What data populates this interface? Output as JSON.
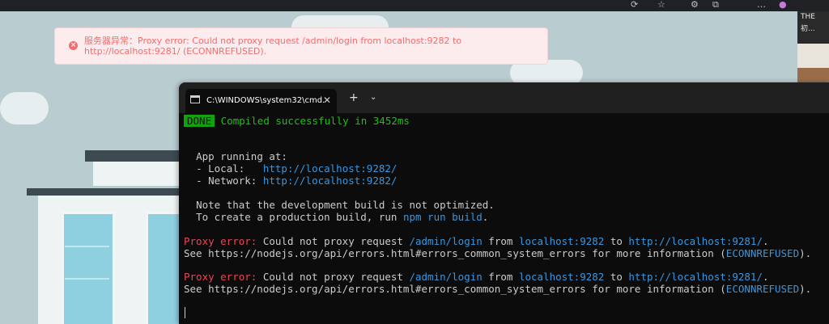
{
  "toast": {
    "message": "服务器异常：Proxy error: Could not proxy request /admin/login from localhost:9282 to http://localhost:9281/ (ECONNREFUSED).",
    "color": "#f56c6c"
  },
  "right_edge": {
    "text_line1": "THE",
    "text_line2": "初..."
  },
  "terminal": {
    "tab_title": "C:\\WINDOWS\\system32\\cmd.",
    "close_glyph": "✕",
    "new_tab_glyph": "+",
    "dropdown_glyph": "⌄",
    "done_badge": "DONE",
    "compiled_msg": "Compiled successfully in 3452ms",
    "app_running": "App running at:",
    "local_label": "- Local:   ",
    "local_url": "http://localhost:9282/",
    "network_label": "- Network: ",
    "network_url": "http://localhost:9282/",
    "note_line1": "Note that the development build is not optimized.",
    "note_line2_prefix": "To create a production build, run ",
    "note_line2_cmd": "npm run build",
    "note_line2_suffix": ".",
    "errors": [
      {
        "label": "Proxy error:",
        "text1": " Could not proxy request ",
        "path": "/admin/login",
        "text2": " from ",
        "from": "localhost:9282",
        "text3": " to ",
        "to": "http://localhost:9281/",
        "text4": ".",
        "see_prefix": "See https://nodejs.org/api/errors.html#errors_common_system_errors for more information (",
        "code": "ECONNREFUSED",
        "see_suffix": ")."
      },
      {
        "label": "Proxy error:",
        "text1": " Could not proxy request ",
        "path": "/admin/login",
        "text2": " from ",
        "from": "localhost:9282",
        "text3": " to ",
        "to": "http://localhost:9281/",
        "text4": ".",
        "see_prefix": "See https://nodejs.org/api/errors.html#errors_common_system_errors for more information (",
        "code": "ECONNREFUSED",
        "see_suffix": ")."
      }
    ]
  }
}
